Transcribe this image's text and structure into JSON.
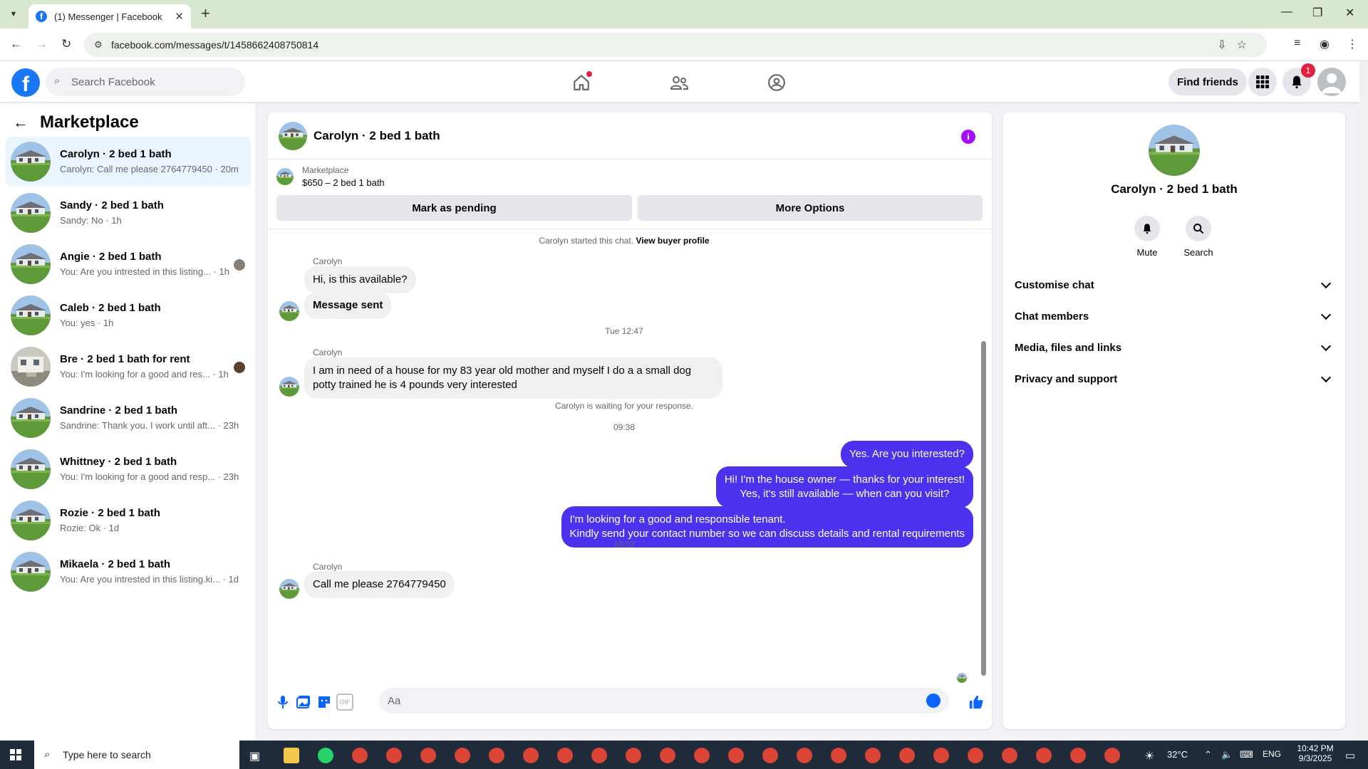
{
  "browser": {
    "tab_title": "(1) Messenger | Facebook",
    "url": "facebook.com/messages/t/1458662408750814"
  },
  "header": {
    "search_placeholder": "Search Facebook",
    "find_friends": "Find friends",
    "notification_count": "1"
  },
  "sidebar": {
    "title": "Marketplace",
    "conversations": [
      {
        "name": "Carolyn · 2 bed 1 bath",
        "snippet": "Carolyn: Call me please 2764779450 · 20m"
      },
      {
        "name": "Sandy · 2 bed 1 bath",
        "snippet": "Sandy: No · 1h"
      },
      {
        "name": "Angie · 2 bed 1 bath",
        "snippet": "You: Are you intrested in this listing... · 1h"
      },
      {
        "name": "Caleb · 2 bed 1 bath",
        "snippet": "You: yes · 1h"
      },
      {
        "name": "Bre · 2 bed 1 bath for rent",
        "snippet": "You: I'm looking for a good and res... · 1h"
      },
      {
        "name": "Sandrine · 2 bed 1 bath",
        "snippet": "Sandrine: Thank you. I work until aft... · 23h"
      },
      {
        "name": "Whittney · 2 bed 1 bath",
        "snippet": "You: I'm looking for a good and resp... · 23h"
      },
      {
        "name": "Rozie · 2 bed 1 bath",
        "snippet": "Rozie: Ok · 1d"
      },
      {
        "name": "Mikaela · 2 bed 1 bath",
        "snippet": "You: Are you intrested in this listing.ki... · 1d"
      }
    ]
  },
  "chat": {
    "title": "Carolyn · 2 bed 1 bath",
    "marketplace_label": "Marketplace",
    "listing": "$650 – 2 bed 1 bath",
    "mark_pending": "Mark as pending",
    "more_options": "More Options",
    "started_text": "Carolyn started this chat.",
    "view_profile": "View buyer profile",
    "sender_name": "Carolyn",
    "msg1": "Hi, is this available?",
    "msg2": "Message sent",
    "stamp1": "Tue 12:47",
    "msg3_line1": "I am in need of a house for my 83 year old mother and myself I do a a small dog",
    "msg3_line2": "potty trained he is 4 pounds very interested",
    "waiting": "Carolyn is waiting for your response.",
    "stamp2": "09:38",
    "out1": "Yes. Are you interested?",
    "out2_line1": "Hi! I'm the house owner — thanks for your interest!",
    "out2_line2": "Yes, it's still available — when can you visit?",
    "out3_line1": "I'm looking for a good and responsible tenant.",
    "out3_line2": "Kindly send your contact number so we can discuss details and rental requirements",
    "stamp3": "10:22",
    "msg4": "Call me please 2764779450",
    "composer_placeholder": "Aa",
    "gif_label": "GIF"
  },
  "info_panel": {
    "name": "Carolyn · 2 bed 1 bath",
    "mute": "Mute",
    "search": "Search",
    "sections": [
      "Customise chat",
      "Chat members",
      "Media, files and links",
      "Privacy and support"
    ]
  },
  "taskbar": {
    "search_placeholder": "Type here to search",
    "temperature": "32°C",
    "language": "ENG",
    "time": "10:42 PM",
    "date": "9/3/2025"
  },
  "colors": {
    "brand": "#1877f2",
    "outgoing_bubble": "#4b32ec",
    "info_button": "#a40dff"
  }
}
